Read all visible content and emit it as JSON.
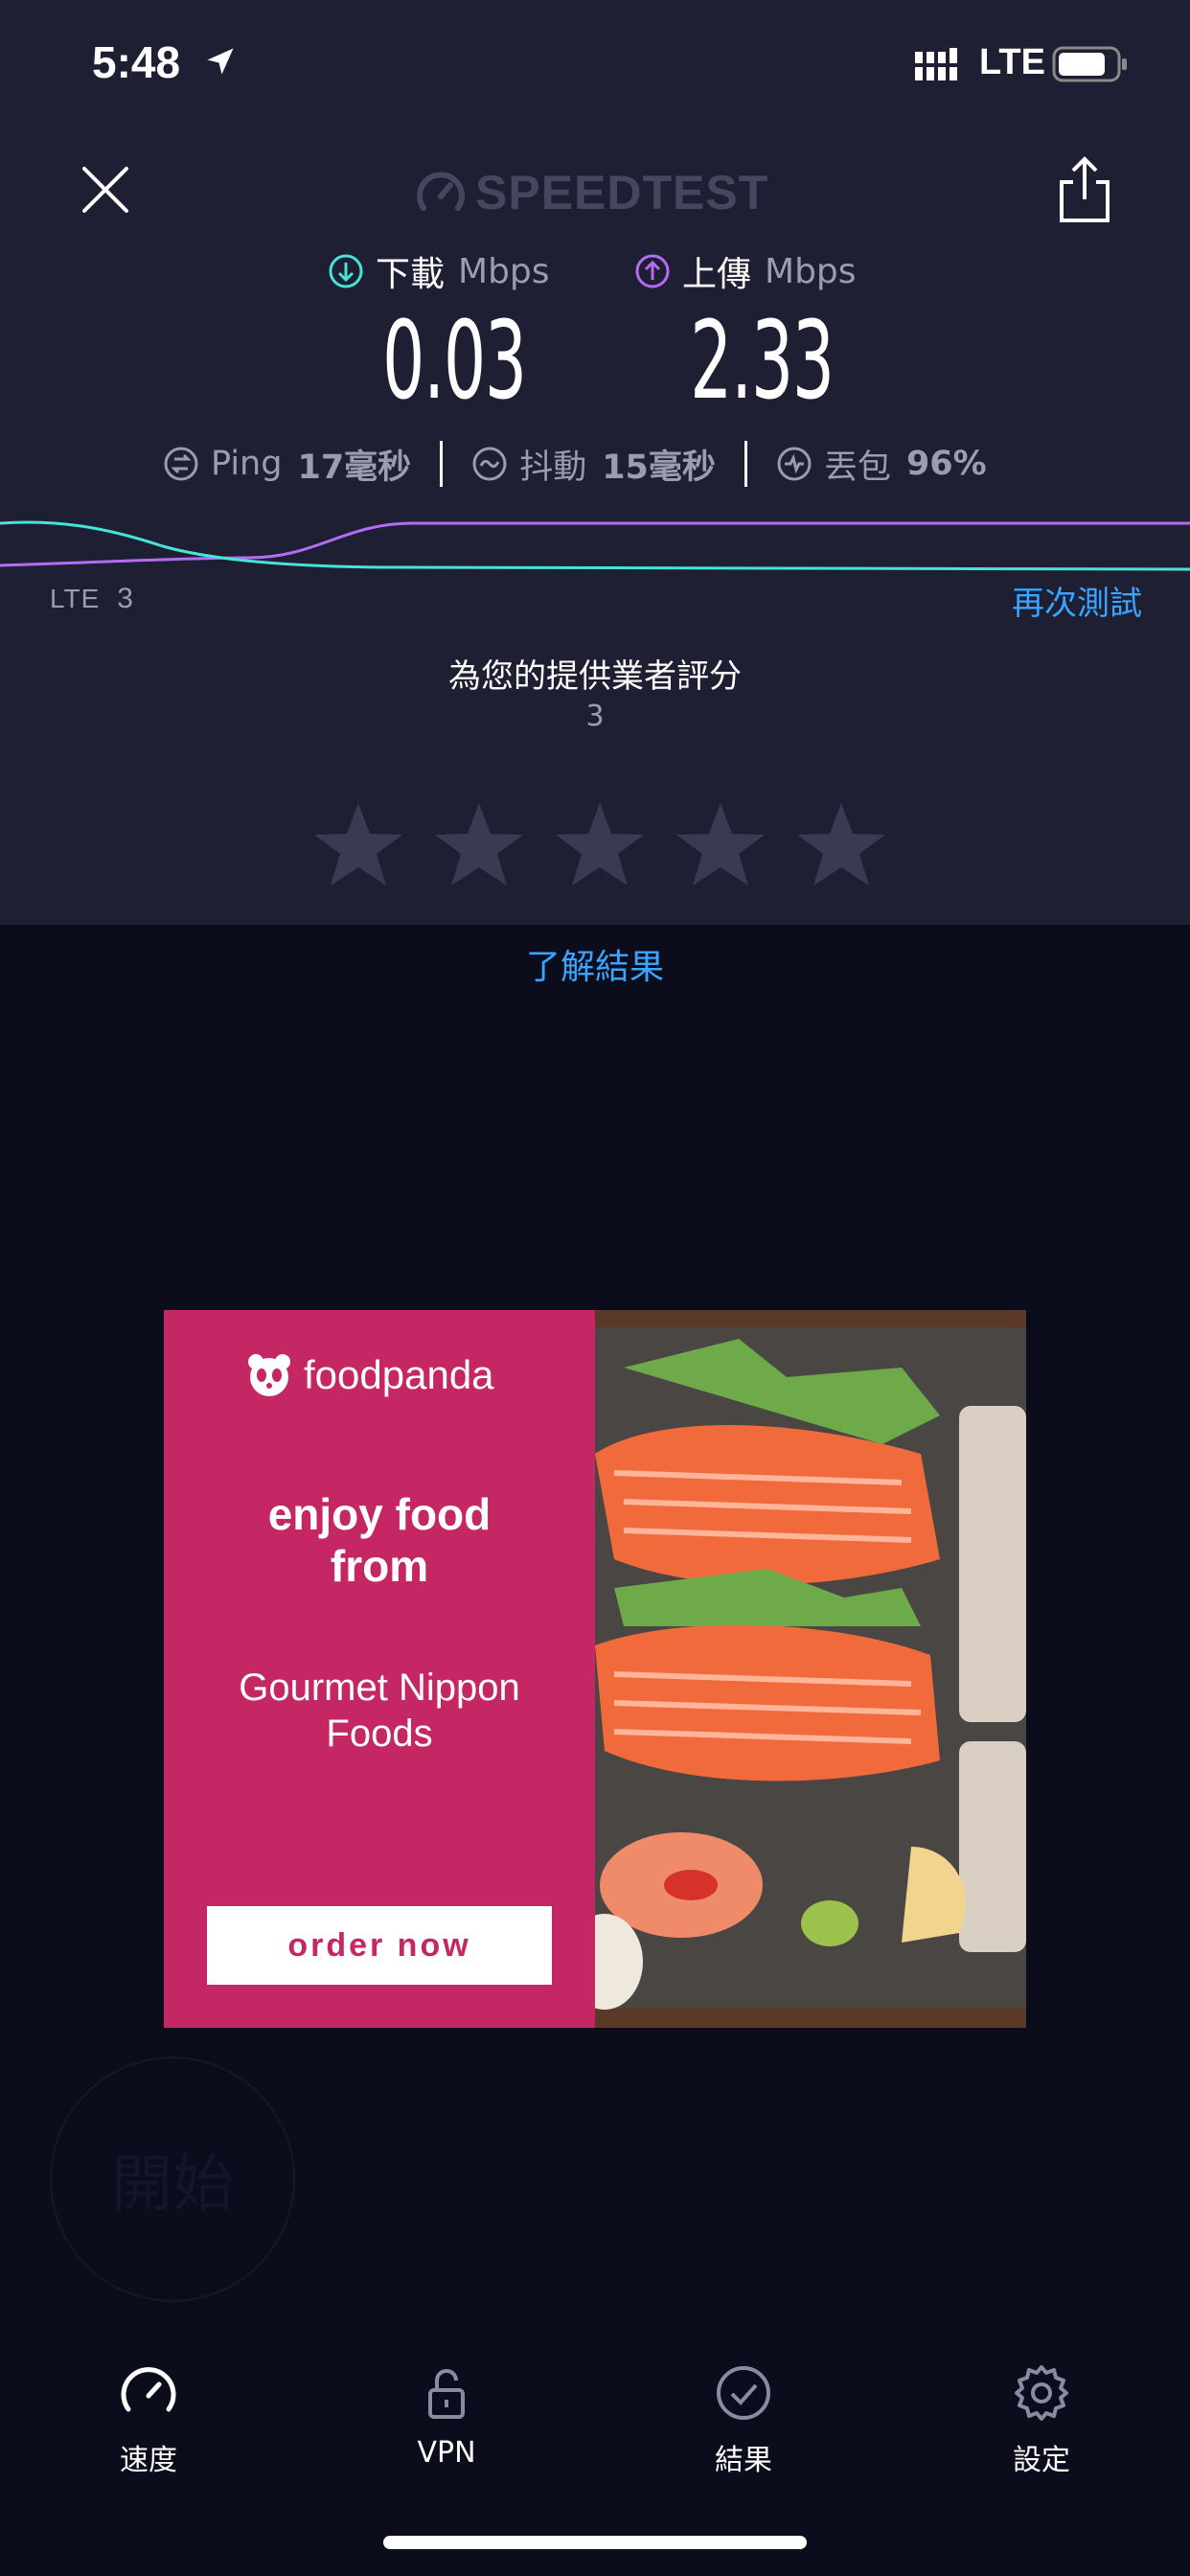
{
  "status_bar": {
    "time": "5:48",
    "network": "LTE"
  },
  "header": {
    "logo_text": "SPEEDTEST"
  },
  "download": {
    "label": "下載",
    "unit": "Mbps",
    "value": "0.03",
    "color": "#46e3d9"
  },
  "upload": {
    "label": "上傳",
    "unit": "Mbps",
    "value": "2.33",
    "color": "#b36cf2"
  },
  "stats": {
    "ping": {
      "label": "Ping",
      "value": "17毫秒"
    },
    "jitter": {
      "label": "抖動",
      "value": "15毫秒"
    },
    "loss": {
      "label": "丟包",
      "value": "96%"
    }
  },
  "connection": {
    "type": "LTE",
    "number": "3"
  },
  "retest_label": "再次測試",
  "rating": {
    "title": "為您的提供業者評分",
    "subtitle": "3",
    "stars_total": 5,
    "stars_selected": 0
  },
  "learn_link": "了解結果",
  "ad": {
    "brand": "foodpanda",
    "headline_line1": "enjoy food",
    "headline_line2": "from",
    "restaurant_line1": "Gourmet Nippon",
    "restaurant_line2": "Foods",
    "cta": "order now",
    "brand_color": "#c52764"
  },
  "start_button": "開始",
  "tabs": [
    {
      "label": "速度",
      "icon": "speed-gauge-icon",
      "active": true
    },
    {
      "label": "VPN",
      "icon": "unlock-icon",
      "active": false
    },
    {
      "label": "結果",
      "icon": "check-circle-icon",
      "active": false
    },
    {
      "label": "設定",
      "icon": "gear-icon",
      "active": false
    }
  ]
}
